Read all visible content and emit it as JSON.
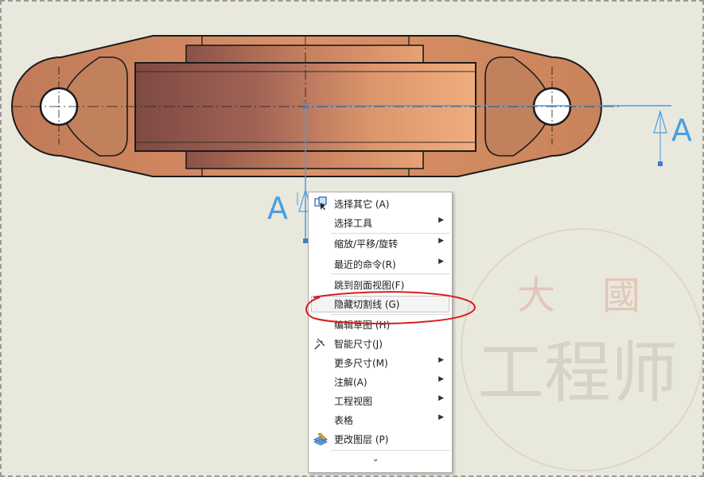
{
  "section_label_left": "A",
  "section_label_right": "A",
  "context_menu": {
    "items": [
      {
        "label": "选择其它 (A)",
        "submenu": false,
        "icon": "select-other-icon"
      },
      {
        "label": "选择工具",
        "submenu": true,
        "icon": ""
      },
      {
        "label": "缩放/平移/旋转",
        "submenu": true,
        "icon": ""
      },
      {
        "label": "最近的命令(R)",
        "submenu": true,
        "icon": ""
      },
      {
        "label": "跳到剖面视图(F)",
        "submenu": false,
        "icon": ""
      },
      {
        "label": "隐藏切割线 (G)",
        "submenu": false,
        "icon": "",
        "highlighted": true
      },
      {
        "label": "编辑草图 (H)",
        "submenu": false,
        "icon": ""
      },
      {
        "label": "智能尺寸(J)",
        "submenu": false,
        "icon": "smart-dimension-icon"
      },
      {
        "label": "更多尺寸(M)",
        "submenu": true,
        "icon": ""
      },
      {
        "label": "注解(A)",
        "submenu": true,
        "icon": ""
      },
      {
        "label": "工程视图",
        "submenu": true,
        "icon": ""
      },
      {
        "label": "表格",
        "submenu": true,
        "icon": ""
      },
      {
        "label": "更改图层 (P)",
        "submenu": false,
        "icon": "change-layer-icon"
      }
    ],
    "more_glyph": "⌄"
  },
  "watermark": {
    "top_chars": [
      "大",
      "國"
    ],
    "bottom_text": "工程师"
  },
  "colors": {
    "background": "#e9e8dc",
    "part_light": "#e8a070",
    "part_dark": "#9a5a4a",
    "section_line": "#4a9ee0",
    "annotation_red": "#d81e1e"
  }
}
